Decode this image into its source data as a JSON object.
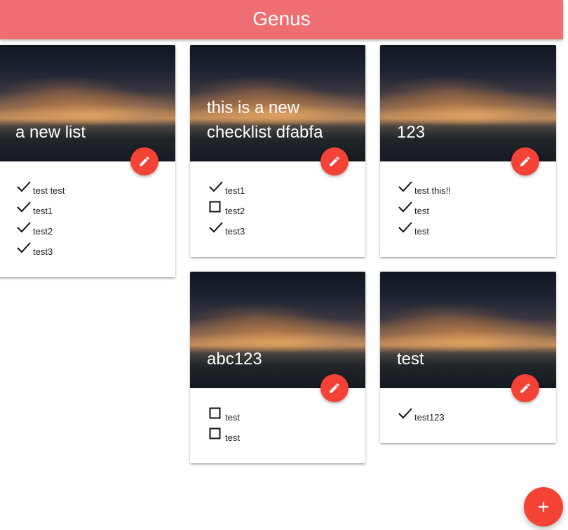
{
  "app": {
    "title": "Genus",
    "brand_color": "#ee6e73",
    "accent_color": "#f44336"
  },
  "lists": [
    {
      "title": "a new list",
      "items": [
        {
          "label": "test test",
          "checked": true
        },
        {
          "label": "test1",
          "checked": true
        },
        {
          "label": "test2",
          "checked": true
        },
        {
          "label": "test3",
          "checked": true
        }
      ]
    },
    {
      "title": "this is a new checklist dfabfa",
      "items": [
        {
          "label": "test1",
          "checked": true
        },
        {
          "label": "test2",
          "checked": false
        },
        {
          "label": "test3",
          "checked": true
        }
      ]
    },
    {
      "title": "123",
      "items": [
        {
          "label": "test this!!",
          "checked": true
        },
        {
          "label": "test",
          "checked": true
        },
        {
          "label": "test",
          "checked": true
        }
      ]
    },
    {
      "title": "abc123",
      "items": [
        {
          "label": "test",
          "checked": false
        },
        {
          "label": "test",
          "checked": false
        }
      ]
    },
    {
      "title": "test",
      "items": [
        {
          "label": "test123",
          "checked": true
        }
      ]
    }
  ],
  "icons": {
    "edit": "pencil-icon",
    "add": "plus-icon",
    "checked": "checkmark-icon",
    "unchecked": "empty-checkbox-icon"
  }
}
